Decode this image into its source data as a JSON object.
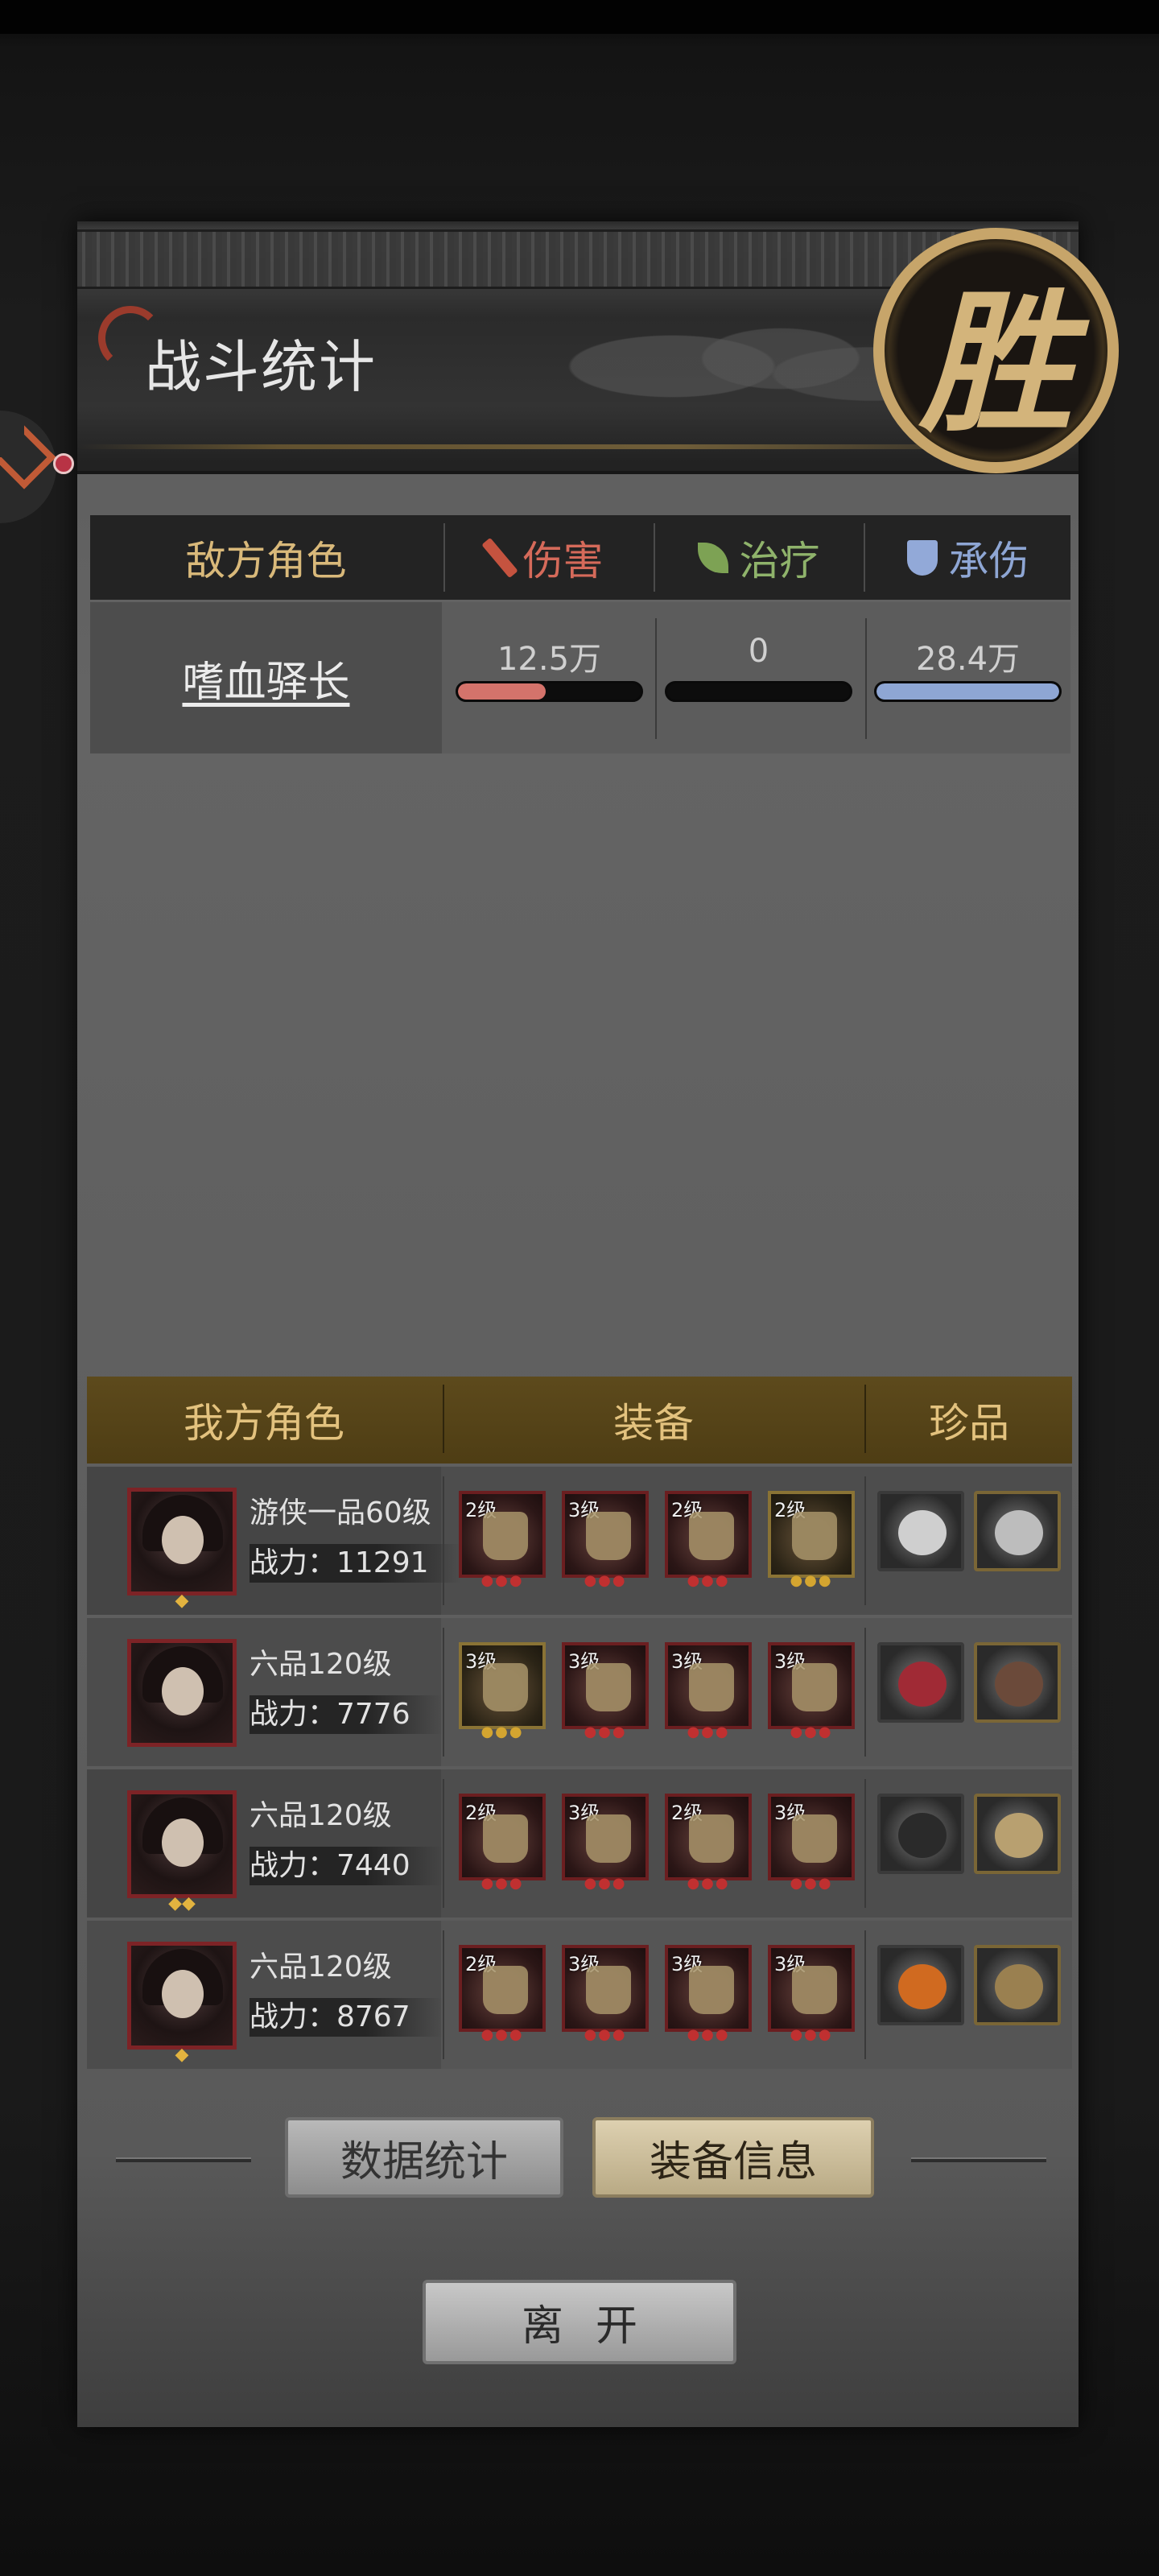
{
  "panel": {
    "title": "战斗统计",
    "victory_glyph": "胜"
  },
  "enemy_table": {
    "headers": {
      "role": "敌方角色",
      "damage": "伤害",
      "healing": "治疗",
      "taken": "承伤"
    },
    "rows": [
      {
        "name": "嗜血驿长",
        "damage": {
          "text": "12.5万",
          "fill_pct": 48
        },
        "healing": {
          "text": "0",
          "fill_pct": 0
        },
        "taken": {
          "text": "28.4万",
          "fill_pct": 100
        }
      }
    ],
    "colors": {
      "damage": "#d4736b",
      "healing": "#8fb36b",
      "taken": "#8ea6d4"
    }
  },
  "ally_table": {
    "headers": {
      "role": "我方角色",
      "equipment": "装备",
      "treasure": "珍品"
    },
    "rows": [
      {
        "rank": "游侠一品60级",
        "power": "战力：11291",
        "gems": "◆",
        "equipment": [
          {
            "level": "2级",
            "tier": "red"
          },
          {
            "level": "3级",
            "tier": "red"
          },
          {
            "level": "2级",
            "tier": "red"
          },
          {
            "level": "2级",
            "tier": "gold"
          }
        ],
        "treasures": [
          "wolf-statue",
          "lion-statue"
        ]
      },
      {
        "rank": "六品120级",
        "power": "战力：7776",
        "gems": "",
        "equipment": [
          {
            "level": "3级",
            "tier": "gold"
          },
          {
            "level": "3级",
            "tier": "red"
          },
          {
            "level": "3级",
            "tier": "red"
          },
          {
            "level": "3级",
            "tier": "red"
          }
        ],
        "treasures": [
          "red-fan",
          "cloth-pouch"
        ]
      },
      {
        "rank": "六品120级",
        "power": "战力：7440",
        "gems": "◆◆",
        "equipment": [
          {
            "level": "2级",
            "tier": "red"
          },
          {
            "level": "3级",
            "tier": "red"
          },
          {
            "level": "2级",
            "tier": "red"
          },
          {
            "level": "3级",
            "tier": "red"
          }
        ],
        "treasures": [
          "black-box",
          "comb"
        ]
      },
      {
        "rank": "六品120级",
        "power": "战力：8767",
        "gems": "◆",
        "equipment": [
          {
            "level": "2级",
            "tier": "red"
          },
          {
            "level": "3级",
            "tier": "red"
          },
          {
            "level": "3级",
            "tier": "red"
          },
          {
            "level": "3级",
            "tier": "red"
          }
        ],
        "treasures": [
          "amber-stone",
          "feather-ornament"
        ]
      }
    ]
  },
  "buttons": {
    "stats": "数据统计",
    "equip_info": "装备信息",
    "leave": "离开"
  }
}
